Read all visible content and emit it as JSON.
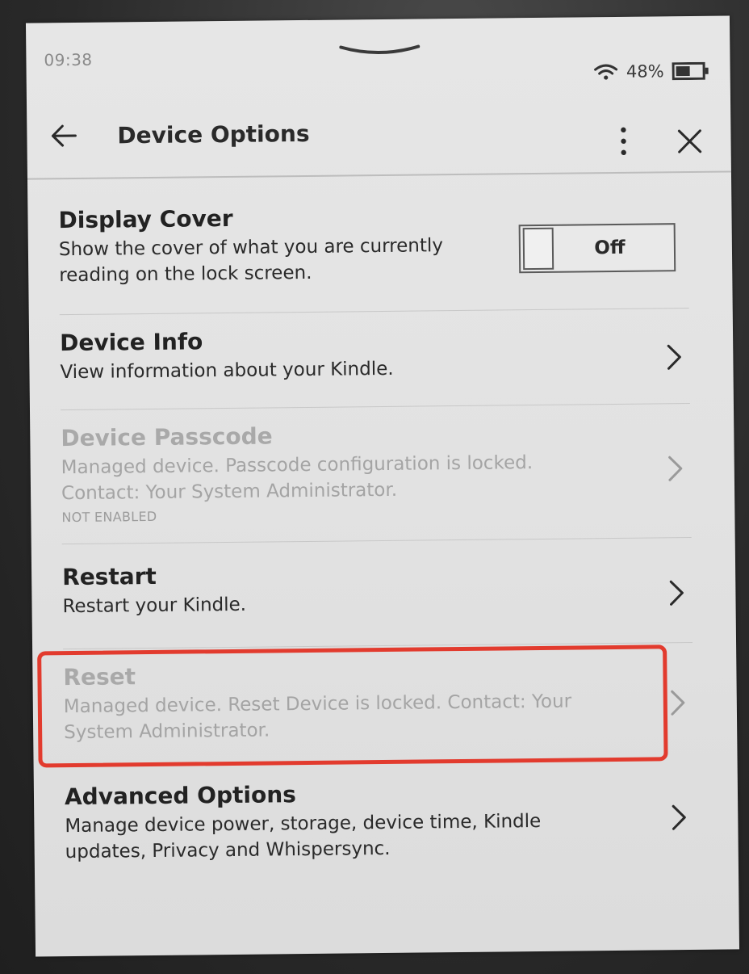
{
  "status": {
    "time": "09:38",
    "battery": "48%"
  },
  "header": {
    "title": "Device Options"
  },
  "items": [
    {
      "title": "Display Cover",
      "desc": "Show the cover of what you are currently reading on the lock screen.",
      "toggle": "Off"
    },
    {
      "title": "Device Info",
      "desc": "View information about your Kindle."
    },
    {
      "title": "Device Passcode",
      "desc": "Managed device. Passcode configuration is locked. Contact: Your System Administrator.",
      "sub": "NOT ENABLED"
    },
    {
      "title": "Restart",
      "desc": "Restart your Kindle."
    },
    {
      "title": "Reset",
      "desc": "Managed device. Reset Device is locked. Contact: Your System Administrator."
    },
    {
      "title": "Advanced Options",
      "desc": "Manage device power, storage, device time, Kindle updates, Privacy and Whispersync."
    }
  ],
  "colors": {
    "highlight": "#e23b2e",
    "disabled_text": "#a9a9a9"
  }
}
